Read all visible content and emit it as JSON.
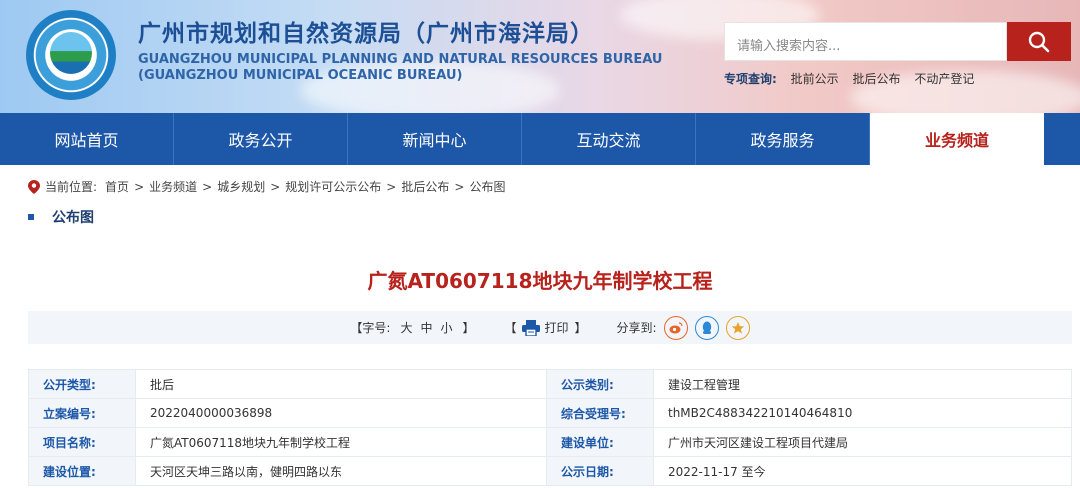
{
  "header": {
    "title_cn": "广州市规划和自然资源局（广州市海洋局）",
    "title_en_1": "GUANGZHOU MUNICIPAL PLANNING AND NATURAL RESOURCES BUREAU",
    "title_en_2": "(GUANGZHOU MUNICIPAL OCEANIC BUREAU)",
    "logo_icon": "bureau-emblem",
    "search_placeholder": "请输入搜索内容...",
    "search_icon": "search-icon",
    "quick_label": "专项查询:",
    "quick_links": [
      "批前公示",
      "批后公布",
      "不动产登记"
    ]
  },
  "nav": {
    "items": [
      "网站首页",
      "政务公开",
      "新闻中心",
      "互动交流",
      "政务服务",
      "业务频道"
    ],
    "active_index": 5
  },
  "breadcrumb": {
    "label": "当前位置:",
    "items": [
      "首页",
      "业务频道",
      "城乡规划",
      "规划许可公示公布",
      "批后公布",
      "公布图"
    ],
    "separator": ">"
  },
  "section": {
    "title": "公布图"
  },
  "article": {
    "title": "广氮AT0607118地块九年制学校工程"
  },
  "toolbar": {
    "font_label": "【字号:",
    "font_sizes": [
      "大",
      "中",
      "小"
    ],
    "font_close": "】",
    "print_open": "【",
    "print_label": "打印",
    "print_close": "】",
    "share_label": "分享到:",
    "share_icons": [
      "weibo-icon",
      "qq-icon",
      "qzone-icon"
    ]
  },
  "info": {
    "rows": [
      [
        {
          "k": "公开类型:",
          "v": "批后"
        },
        {
          "k": "公示类别:",
          "v": "建设工程管理"
        }
      ],
      [
        {
          "k": "立案编号:",
          "v": "2022040000036898"
        },
        {
          "k": "综合受理号:",
          "v": "thMB2C488342210140464810"
        }
      ],
      [
        {
          "k": "项目名称:",
          "v": "广氮AT0607118地块九年制学校工程"
        },
        {
          "k": "建设单位:",
          "v": "广州市天河区建设工程项目代建局"
        }
      ],
      [
        {
          "k": "建设位置:",
          "v": "天河区天坤三路以南，健明四路以东"
        },
        {
          "k": "公示日期:",
          "v": "2022-11-17 至今"
        }
      ]
    ]
  },
  "colors": {
    "brand_blue": "#1d57a8",
    "accent_red": "#b8221c"
  }
}
